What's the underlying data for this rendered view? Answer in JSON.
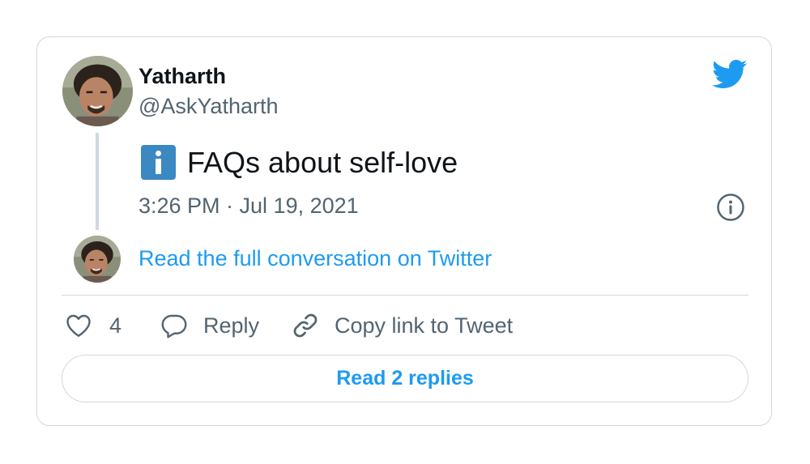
{
  "author": {
    "name": "Yatharth",
    "handle": "@AskYatharth"
  },
  "tweet": {
    "emoji_icon": "information-emoji",
    "text": "FAQs about self-love",
    "timestamp": "3:26 PM · Jul 19, 2021"
  },
  "conversation_link": "Read the full conversation on Twitter",
  "actions": {
    "like_count": "4",
    "reply_label": "Reply",
    "copy_label": "Copy link to Tweet"
  },
  "read_replies_label": "Read 2 replies",
  "colors": {
    "accent": "#1d9bf0",
    "secondary_text": "#536471",
    "border": "#cfd9de",
    "info_emoji": "#3b88c3"
  }
}
